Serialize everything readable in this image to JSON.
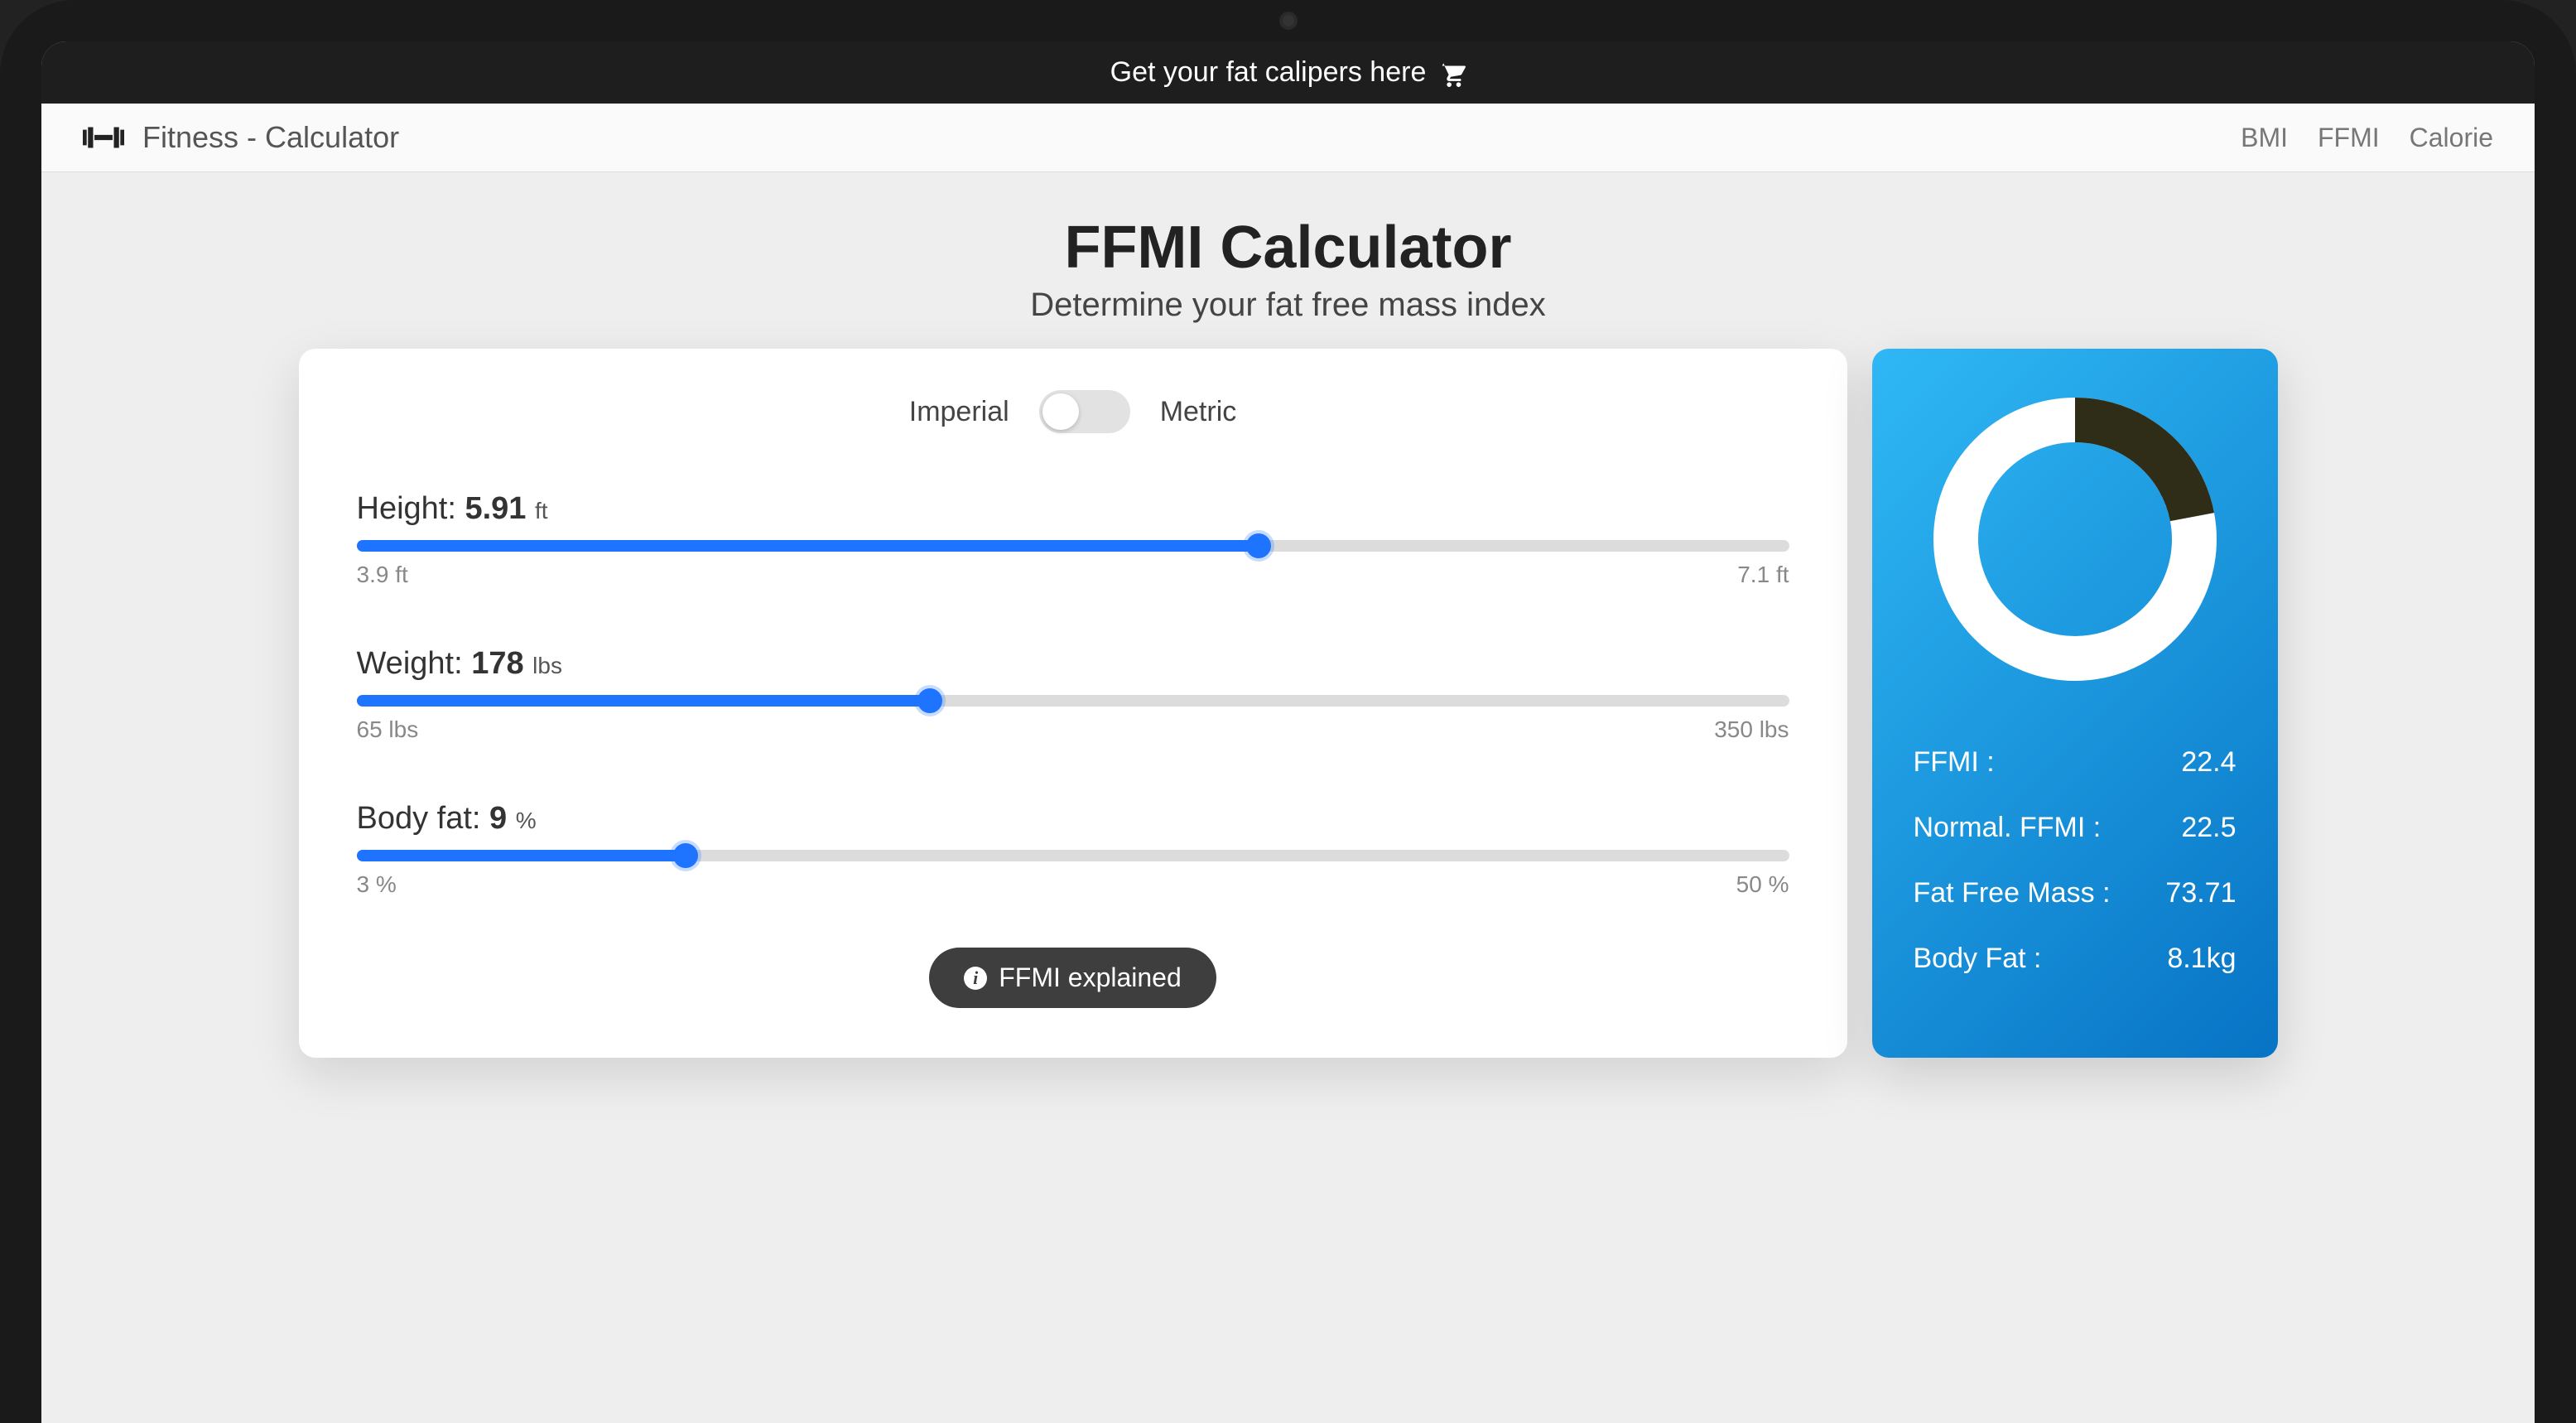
{
  "topbar": {
    "promo": "Get your fat calipers here"
  },
  "nav": {
    "brand": "Fitness - Calculator",
    "links": [
      "BMI",
      "FFMI",
      "Calorie"
    ]
  },
  "hero": {
    "title": "FFMI Calculator",
    "subtitle": "Determine your fat free mass index"
  },
  "units": {
    "left": "Imperial",
    "right": "Metric"
  },
  "sliders": {
    "height": {
      "label": "Height:",
      "value": "5.91",
      "unit": "ft",
      "min": "3.9 ft",
      "max": "7.1 ft",
      "fillPct": 63
    },
    "weight": {
      "label": "Weight:",
      "value": "178",
      "unit": "lbs",
      "min": "65 lbs",
      "max": "350 lbs",
      "fillPct": 40
    },
    "bodyfat": {
      "label": "Body fat:",
      "value": "9",
      "unit": "%",
      "min": "3 %",
      "max": "50 %",
      "fillPct": 23
    }
  },
  "explain_label": "FFMI explained",
  "results": {
    "donutPct": 22,
    "rows": [
      {
        "label": "FFMI :",
        "value": "22.4"
      },
      {
        "label": "Normal. FFMI :",
        "value": "22.5"
      },
      {
        "label": "Fat Free Mass :",
        "value": "73.71"
      },
      {
        "label": "Body Fat :",
        "value": "8.1kg"
      }
    ]
  }
}
